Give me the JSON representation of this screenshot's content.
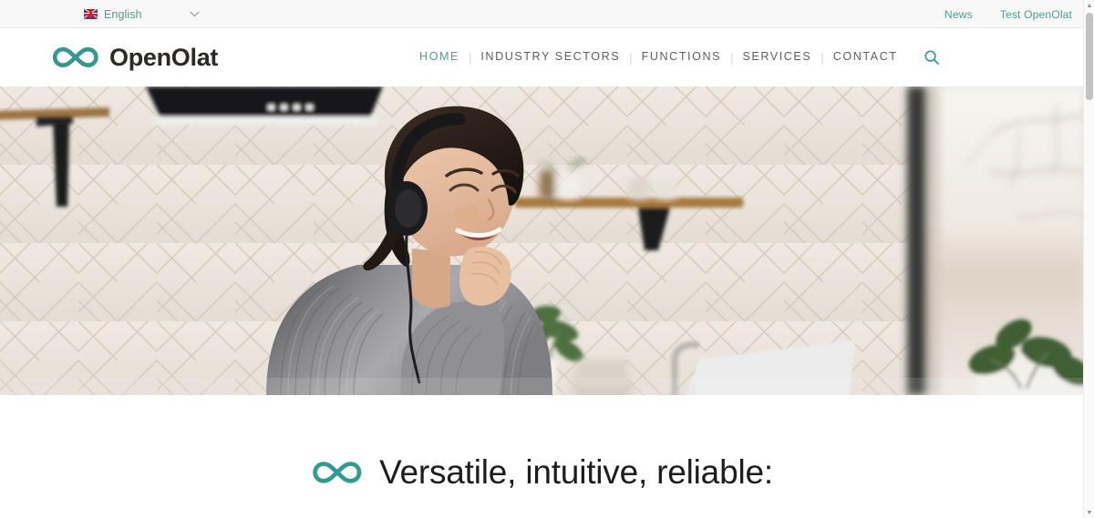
{
  "topbar": {
    "language": {
      "label": "English",
      "flag_icon": "uk-flag-icon",
      "caret_icon": "chevron-down-icon",
      "caret_glyph": "⌄"
    },
    "links": [
      {
        "label": "News"
      },
      {
        "label": "Test OpenOlat"
      }
    ],
    "link_color": "#4a9e95",
    "background": "#f8f8f8"
  },
  "header": {
    "brand": {
      "name": "OpenOlat",
      "logo_icon": "infinity-icon",
      "logo_color": "#3a9b93",
      "text_color": "#2e2a23"
    },
    "nav": {
      "items": [
        {
          "label": "HOME",
          "active": true
        },
        {
          "label": "INDUSTRY SECTORS",
          "active": false
        },
        {
          "label": "FUNCTIONS",
          "active": false
        },
        {
          "label": "SERVICES",
          "active": false
        },
        {
          "label": "CONTACT",
          "active": false
        }
      ],
      "separator": "|",
      "active_color": "#4a9e95",
      "inactive_color": "#595f63"
    },
    "search": {
      "icon": "search-icon",
      "color": "#3a9b93"
    }
  },
  "hero": {
    "alt": "Smiling woman with headphones sitting at a kitchen counter with a laptop",
    "scene": {
      "backsplash": "white herringbone tile",
      "range_hood": "black",
      "shelf": "wooden shelf with black brackets",
      "window": "bare tree branches outside",
      "plant": "green potted plant",
      "subject": "woman in grey knit sweater wearing black headphones"
    }
  },
  "section": {
    "headline": "Versatile, intuitive, reliable:",
    "headline_icon": "infinity-icon",
    "headline_icon_color": "#3a9e99",
    "headline_color": "#1d1d1b"
  },
  "scrollbar": {
    "up_glyph": "▲",
    "down_glyph": "▼"
  }
}
